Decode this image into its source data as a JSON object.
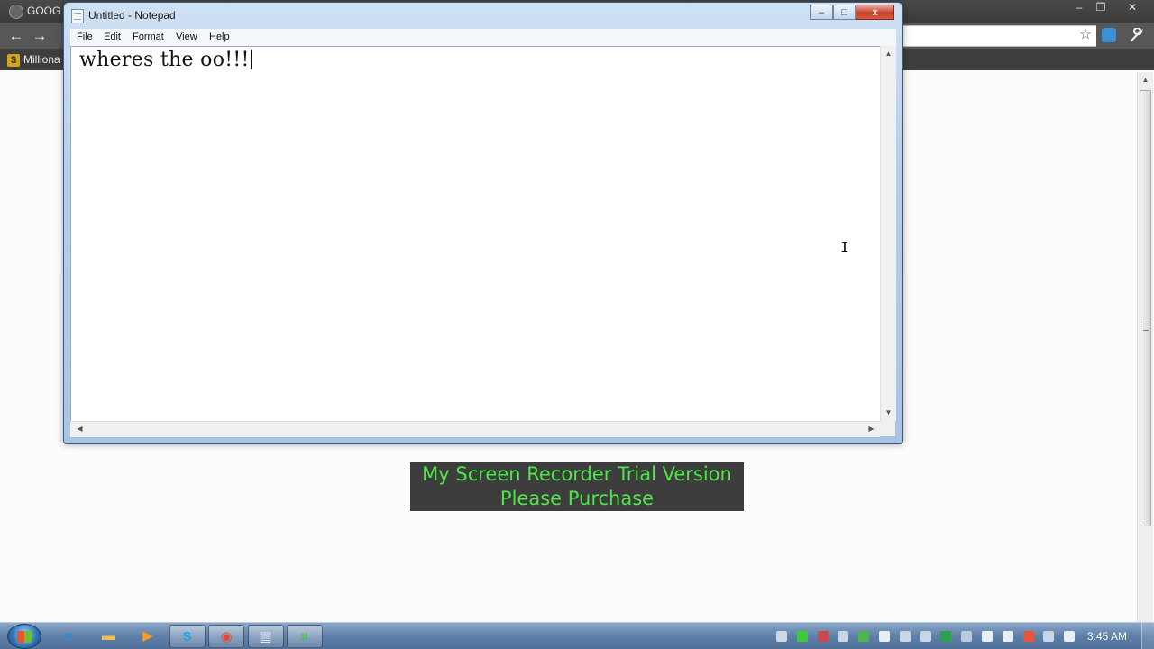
{
  "browser": {
    "tab_title": "GOOG",
    "bookmark": "Milliona",
    "window_controls": {
      "minimize": "‒",
      "maximize": "❐",
      "close": "✕"
    },
    "nav": {
      "back": "←",
      "forward": "→"
    },
    "icons": {
      "star": "☆",
      "wrench": "🔧"
    }
  },
  "notepad": {
    "title": "Untitled - Notepad",
    "menu": [
      "File",
      "Edit",
      "Format",
      "View",
      "Help"
    ],
    "content": "wheres the oo!!!",
    "controls": {
      "minimize": "‒",
      "maximize": "□",
      "close": "x"
    }
  },
  "watermark": {
    "line1": "My Screen Recorder Trial Version",
    "line2": "Please Purchase"
  },
  "taskbar": {
    "clock": "3:45 AM",
    "buttons": [
      {
        "name": "ie-icon",
        "glyph": "e",
        "color": "#2a8fe0",
        "active": false
      },
      {
        "name": "explorer-folder-icon",
        "glyph": "▬",
        "color": "#f0c24a",
        "active": false
      },
      {
        "name": "media-player-icon",
        "glyph": "▶",
        "color": "#ff9a1f",
        "active": false
      },
      {
        "name": "skype-icon",
        "glyph": "S",
        "color": "#1aa6e8",
        "active": true
      },
      {
        "name": "chrome-icon",
        "glyph": "◉",
        "color": "#d94a38",
        "active": true
      },
      {
        "name": "notepad-icon",
        "glyph": "▤",
        "color": "#e8f2fb",
        "active": true
      },
      {
        "name": "screen-recorder-icon",
        "glyph": "⌗",
        "color": "#3ec93a",
        "active": true
      }
    ],
    "tray_colors": [
      "#d0d8e4",
      "#3ec93a",
      "#c84a4a",
      "#c8d6e6",
      "#4bb84b",
      "#e8eef6",
      "#c8d6e6",
      "#c8d6e6",
      "#2f9e4f",
      "#b9c9de",
      "#e8eef6",
      "#e8eef6",
      "#e8553a",
      "#c8d6e6",
      "#e8eef6"
    ]
  }
}
